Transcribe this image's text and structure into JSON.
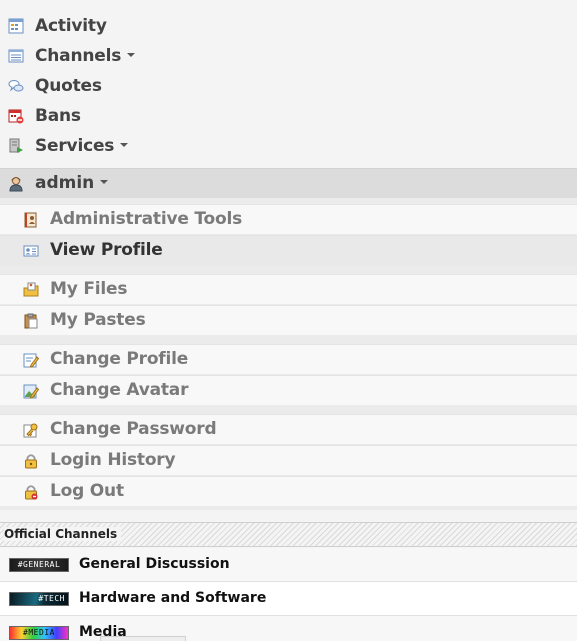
{
  "nav": {
    "items": [
      {
        "label": "Activity",
        "icon": "calendar-icon",
        "dropdown": false
      },
      {
        "label": "Channels",
        "icon": "list-icon",
        "dropdown": true
      },
      {
        "label": "Quotes",
        "icon": "speech-bubbles-icon",
        "dropdown": false
      },
      {
        "label": "Bans",
        "icon": "red-calendar-icon",
        "dropdown": false
      },
      {
        "label": "Services",
        "icon": "server-icon",
        "dropdown": true
      }
    ]
  },
  "user": {
    "label": "admin",
    "icon": "user-icon"
  },
  "user_menu": {
    "items": [
      {
        "label": "Administrative Tools",
        "icon": "admin-tools-icon"
      },
      {
        "label": "View Profile",
        "icon": "profile-card-icon",
        "active": true
      },
      {
        "label": "My Files",
        "icon": "files-icon"
      },
      {
        "label": "My Pastes",
        "icon": "clipboard-icon"
      },
      {
        "label": "Change Profile",
        "icon": "edit-profile-icon"
      },
      {
        "label": "Change Avatar",
        "icon": "edit-avatar-icon"
      },
      {
        "label": "Change Password",
        "icon": "key-icon"
      },
      {
        "label": "Login History",
        "icon": "lock-icon"
      },
      {
        "label": "Log Out",
        "icon": "lock-logout-icon"
      }
    ]
  },
  "channels": {
    "heading": "Official Channels",
    "items": [
      {
        "name": "General Discussion",
        "banner": "#GENERAL"
      },
      {
        "name": "Hardware and Software",
        "banner": "#TECH"
      },
      {
        "name": "Media",
        "banner": "#MEDIA"
      }
    ]
  },
  "colors": {
    "background": "#f4f4f4",
    "admin_bar": "#dcdcdc",
    "menu_text": "#7a7a7a",
    "active_text": "#333333"
  }
}
